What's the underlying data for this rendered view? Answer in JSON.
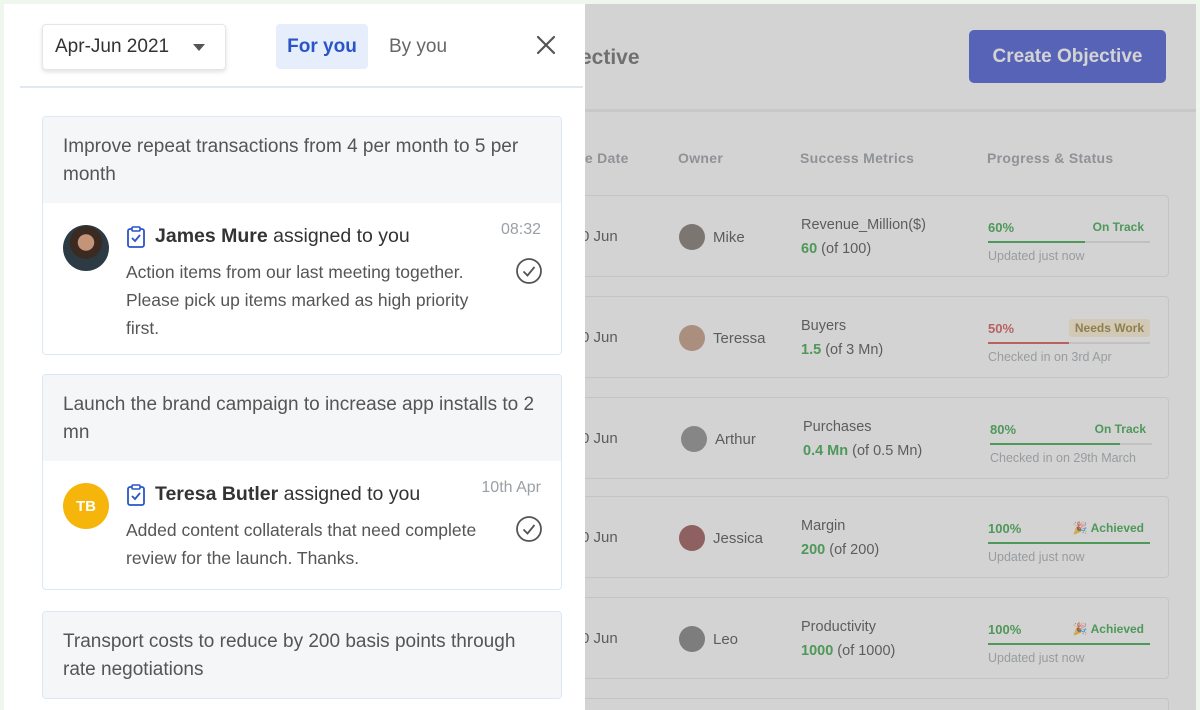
{
  "background": {
    "title_fragment": "ective",
    "create_button": "Create Objective",
    "columns": {
      "due_date": "ue Date",
      "owner": "Owner",
      "success_metrics": "Success Metrics",
      "progress_status": "Progress & Status"
    },
    "rows": [
      {
        "due": "0 Jun",
        "owner": "Mike",
        "metric_name": "Revenue_Million($)",
        "metric_value": "60",
        "metric_total": "(of 100)",
        "progress": "60%",
        "progress_fraction": 0.6,
        "status": "On Track",
        "status_kind": "ok",
        "updated": "Updated just now"
      },
      {
        "due": "0 Jun",
        "owner": "Teressa",
        "metric_name": "Buyers",
        "metric_value": "1.5",
        "metric_total": "(of 3 Mn)",
        "progress": "50%",
        "progress_fraction": 0.5,
        "status": "Needs Work",
        "status_kind": "warn",
        "updated": "Checked in on 3rd Apr"
      },
      {
        "due": "0 Jun",
        "owner": "Arthur",
        "metric_name": "Purchases",
        "metric_value": "0.4 Mn",
        "metric_total": "(of 0.5 Mn)",
        "progress": "80%",
        "progress_fraction": 0.8,
        "status": "On Track",
        "status_kind": "ok",
        "updated": "Checked in on 29th March"
      },
      {
        "due": "0 Jun",
        "owner": "Jessica",
        "metric_name": "Margin",
        "metric_value": "200",
        "metric_total": "(of 200)",
        "progress": "100%",
        "progress_fraction": 1.0,
        "status": "🎉 Achieved",
        "status_kind": "ok",
        "updated": "Updated just now"
      },
      {
        "due": "0 Jun",
        "owner": "Leo",
        "metric_name": "Productivity",
        "metric_value": "1000",
        "metric_total": "(of 1000)",
        "progress": "100%",
        "progress_fraction": 1.0,
        "status": "🎉 Achieved",
        "status_kind": "ok",
        "updated": "Updated just now"
      }
    ]
  },
  "panel": {
    "date_range": "Apr-Jun 2021",
    "tabs": {
      "for_you": "For you",
      "by_you": "By you"
    },
    "cards": [
      {
        "objective": "Improve repeat transactions from 4 per month to 5 per month",
        "assignee_name": "James Mure",
        "assign_text": " assigned to you",
        "time": "08:32",
        "message": "Action items from our last meeting together. Please pick up items marked as high priority first."
      },
      {
        "objective": "Launch the brand campaign to increase app installs to 2 mn",
        "assignee_name": "Teresa Butler",
        "assignee_initials": "TB",
        "assign_text": " assigned to you",
        "time": "10th Apr",
        "message": "Added content collaterals that need complete review for the launch. Thanks."
      },
      {
        "objective": "Transport costs to reduce by 200 basis points through rate negotiations"
      }
    ]
  },
  "colors": {
    "accent_blue": "#2a3fcf",
    "success_green": "#1a9a2e",
    "danger_red": "#d23b3b",
    "avatar_yellow": "#f5b50a"
  }
}
